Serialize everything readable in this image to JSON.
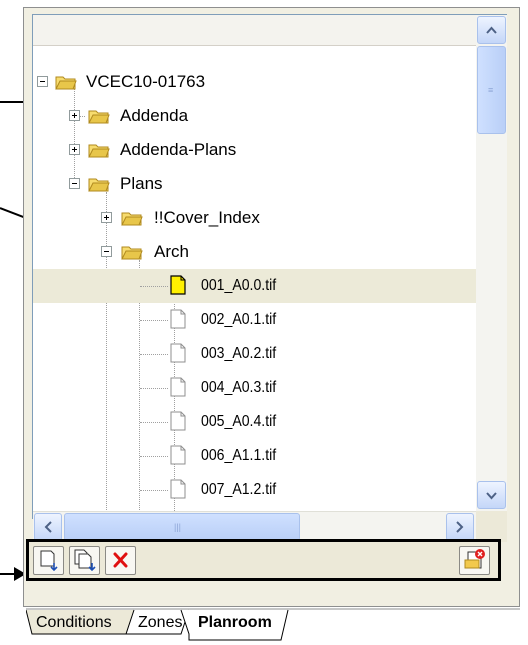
{
  "tree": {
    "root": "VCEC10-01763",
    "items": [
      {
        "label": "Addenda"
      },
      {
        "label": "Addenda-Plans"
      },
      {
        "label": "Plans"
      },
      {
        "label": "!!Cover_Index"
      },
      {
        "label": "Arch"
      }
    ],
    "files": [
      {
        "label": "001_A0.0.tif",
        "selected": true
      },
      {
        "label": "002_A0.1.tif"
      },
      {
        "label": "003_A0.2.tif"
      },
      {
        "label": "004_A0.3.tif"
      },
      {
        "label": "005_A0.4.tif"
      },
      {
        "label": "006_A1.1.tif"
      },
      {
        "label": "007_A1.2.tif"
      }
    ]
  },
  "tabs": {
    "conditions": "Conditions",
    "zones": "Zones",
    "planroom": "Planroom"
  },
  "icons": {
    "folder": "folder-icon",
    "file": "file-icon",
    "delete": "red-x-icon",
    "accent_folder": "#e8c64a",
    "accent_selected_file": "#fff000"
  }
}
